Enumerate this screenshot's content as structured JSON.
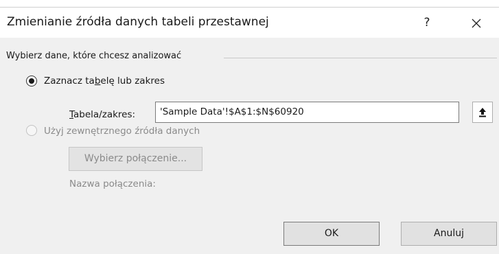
{
  "dialog": {
    "title": "Zmienianie źródła danych tabeli przestawnej",
    "help_glyph": "?",
    "group_label": "Wybierz dane, które chcesz analizować",
    "option_table": {
      "label_pre": "Zaznacz ta",
      "label_accel": "b",
      "label_post": "elę lub zakres",
      "selected": true
    },
    "range_field": {
      "label_accel": "T",
      "label_rest": "abela/zakres:",
      "value": "'Sample Data'!$A$1:$N$60920"
    },
    "option_external": {
      "label": "Użyj zewnętrznego źródła danych",
      "selected": false,
      "enabled": false
    },
    "choose_connection_label": "Wybierz połączenie...",
    "connection_name_label": "Nazwa połączenia:",
    "ok_label": "OK",
    "cancel_label": "Anuluj"
  },
  "colors": {
    "dialog_bg": "#f0f0f0",
    "titlebar_bg": "#ffffff",
    "disabled_text": "#8a8a8a"
  }
}
